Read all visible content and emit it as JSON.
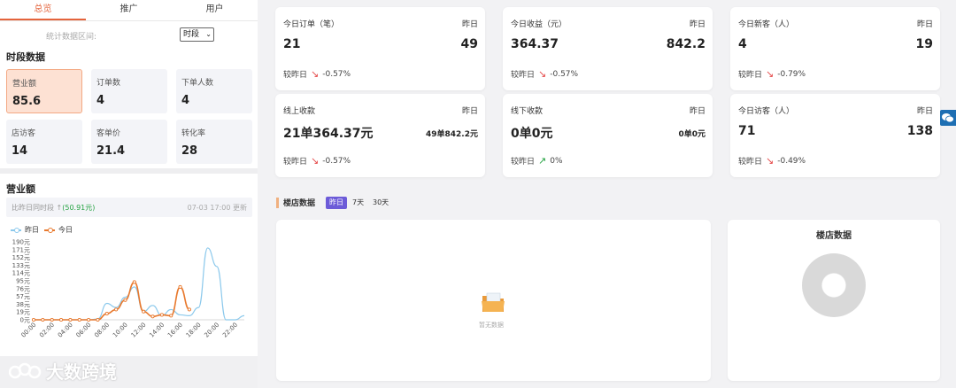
{
  "tabs": [
    "总览",
    "推广",
    "用户"
  ],
  "range": {
    "label": "统计数据区间:",
    "selected": "时段"
  },
  "period_section_title": "时段数据",
  "kpis": [
    {
      "label": "营业额",
      "value": "85.6"
    },
    {
      "label": "订单数",
      "value": "4"
    },
    {
      "label": "下单人数",
      "value": "4"
    },
    {
      "label": "店访客",
      "value": "14"
    },
    {
      "label": "客单价",
      "value": "21.4"
    },
    {
      "label": "转化率",
      "value": "28"
    }
  ],
  "revenue_section_title": "营业额",
  "compare": {
    "label": "比昨日同时段 ↑",
    "value": "(50.91元)",
    "update_time": "07-03 17:00 更新"
  },
  "legend": {
    "yesterday": "昨日",
    "today": "今日"
  },
  "colors": {
    "accent": "#e4643c",
    "yesterday_line": "#8cc9ec",
    "today_line": "#e8792e",
    "down": "#e54848",
    "up": "#26a343",
    "active_pill": "#6c5bd8"
  },
  "chart_data": {
    "type": "line",
    "x": [
      "00:00",
      "01:00",
      "02:00",
      "03:00",
      "04:00",
      "05:00",
      "06:00",
      "07:00",
      "08:00",
      "09:00",
      "10:00",
      "11:00",
      "12:00",
      "13:00",
      "14:00",
      "15:00",
      "16:00",
      "17:00",
      "18:00",
      "19:00",
      "20:00",
      "21:00",
      "22:00",
      "23:00"
    ],
    "xtick_labels": [
      "00:00",
      "02:00",
      "04:00",
      "06:00",
      "08:00",
      "10:00",
      "12:00",
      "14:00",
      "16:00",
      "18:00",
      "20:00",
      "22:00"
    ],
    "ytick_labels": [
      "190元",
      "171元",
      "152元",
      "133元",
      "114元",
      "95元",
      "76元",
      "57元",
      "38元",
      "19元",
      "0元"
    ],
    "ylim": [
      0,
      190
    ],
    "series": [
      {
        "name": "昨日",
        "values": [
          0,
          0,
          0,
          0,
          0,
          0,
          0,
          2,
          40,
          30,
          55,
          80,
          20,
          35,
          10,
          25,
          12,
          10,
          30,
          175,
          130,
          0,
          0,
          10
        ]
      },
      {
        "name": "今日",
        "values": [
          0,
          0,
          0,
          0,
          0,
          0,
          0,
          0,
          15,
          25,
          48,
          92,
          20,
          8,
          12,
          10,
          80,
          25
        ]
      }
    ]
  },
  "metrics": [
    {
      "label": "今日订单（笔）",
      "yday_label": "昨日",
      "value": "21",
      "yday_value": "49",
      "change_label": "较昨日",
      "change": "-0.57%",
      "direction": "down"
    },
    {
      "label": "今日收益（元）",
      "yday_label": "昨日",
      "value": "364.37",
      "yday_value": "842.2",
      "change_label": "较昨日",
      "change": "-0.57%",
      "direction": "down"
    },
    {
      "label": "今日新客（人）",
      "yday_label": "昨日",
      "value": "4",
      "yday_value": "19",
      "change_label": "较昨日",
      "change": "-0.79%",
      "direction": "down"
    },
    {
      "label": "线上收款",
      "yday_label": "昨日",
      "value": "21单364.37元",
      "yday_value": "49单842.2元",
      "change_label": "较昨日",
      "change": "-0.57%",
      "direction": "down"
    },
    {
      "label": "线下收款",
      "yday_label": "昨日",
      "value": "0单0元",
      "yday_value": "0单0元",
      "change_label": "较昨日",
      "change": "0%",
      "direction": "up"
    },
    {
      "label": "今日访客（人）",
      "yday_label": "昨日",
      "value": "71",
      "yday_value": "138",
      "change_label": "较昨日",
      "change": "-0.49%",
      "direction": "down"
    }
  ],
  "store": {
    "title": "楼店数据",
    "periods": [
      "昨日",
      "7天",
      "30天"
    ],
    "empty_text": "暂无数据",
    "pie_title": "楼店数据"
  },
  "brand": {
    "text": "大数跨境"
  }
}
